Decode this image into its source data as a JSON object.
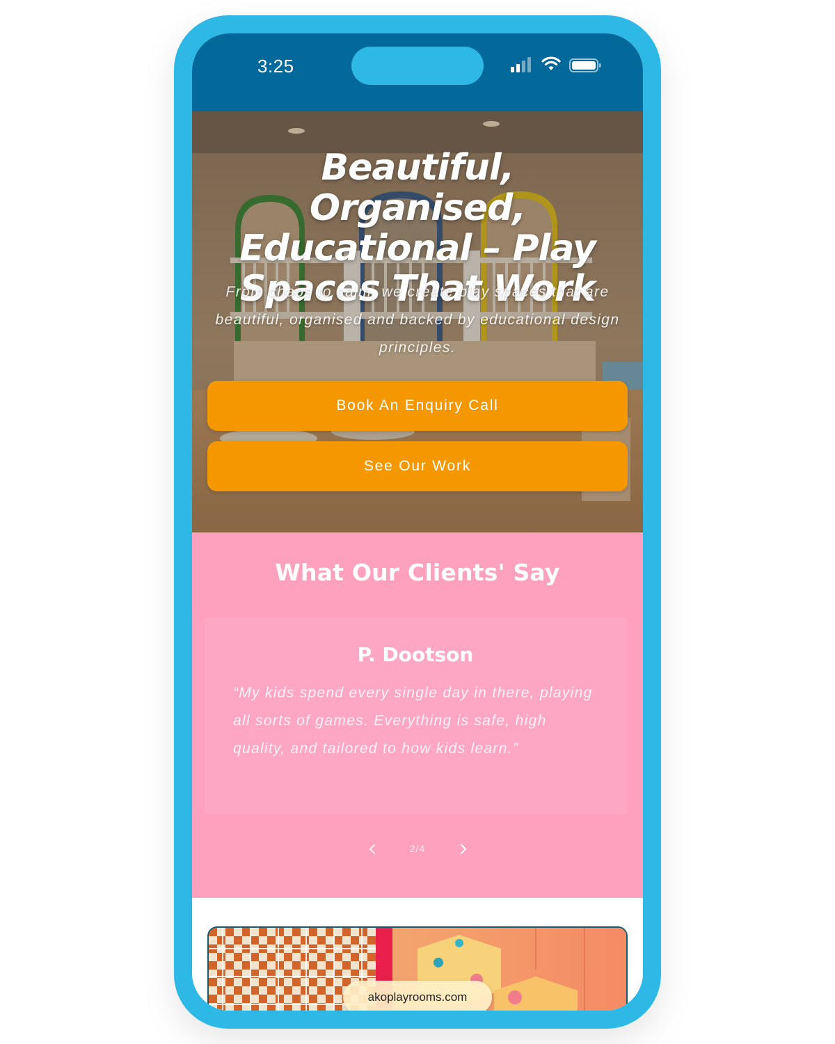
{
  "status_bar": {
    "time": "3:25"
  },
  "hero": {
    "title": "Beautiful, Organised, Educational – Play Spaces That Work",
    "subtitle": "From chaos to calm, we create play spaces that are beautiful, organised and backed by educational design principles.",
    "buttons": {
      "enquiry_label": "Book An Enquiry Call",
      "work_label": "See Our Work"
    }
  },
  "testimonials": {
    "heading": "What Our Clients' Say",
    "current": {
      "name": "P. Dootson",
      "quote": "“My kids spend every single day in there, playing all sorts of games. Everything is safe, high quality, and tailored to how kids learn.”"
    },
    "pager": "2/4"
  },
  "browser": {
    "url": "akoplayrooms.com"
  },
  "colors": {
    "phone_frame": "#2db8e6",
    "status_bar": "#03689a",
    "button": "#f59700",
    "testimonial_bg": "#fea1bf"
  },
  "icons": {
    "signal": "cellular-signal-icon",
    "wifi": "wifi-icon",
    "battery": "battery-icon",
    "prev": "chevron-left-icon",
    "next": "chevron-right-icon"
  }
}
